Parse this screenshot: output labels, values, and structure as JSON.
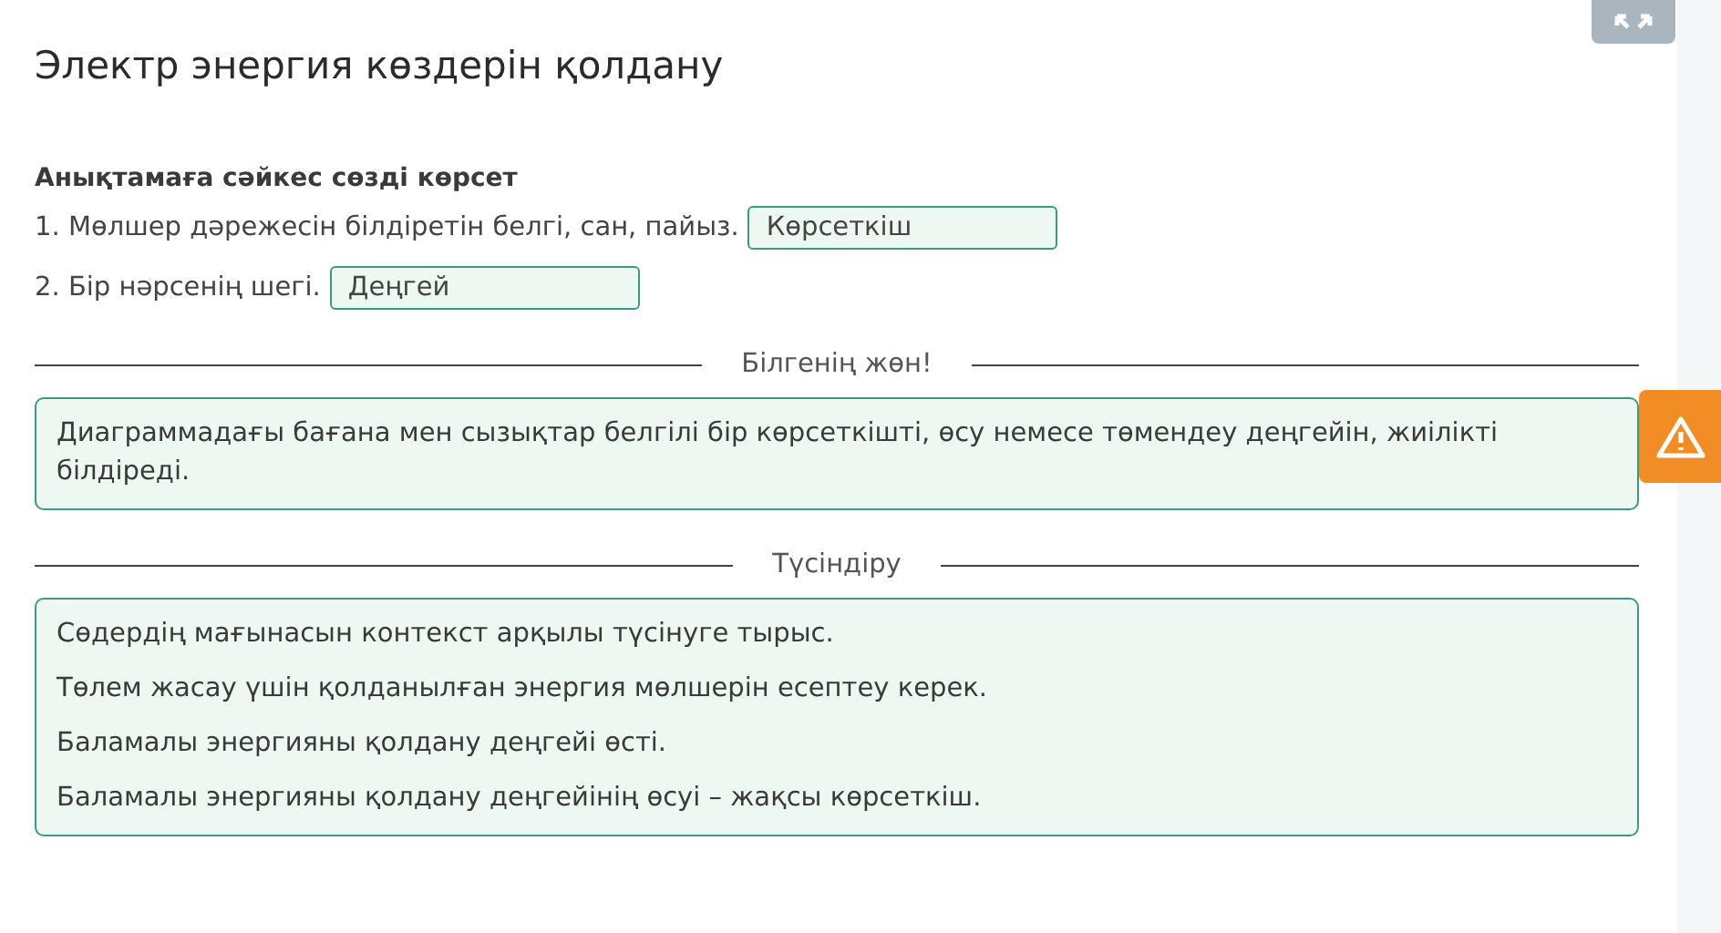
{
  "title": "Электр энергия көздерін қолдану",
  "instruction": "Анықтамаға сәйкес сөзді көрсет",
  "questions": [
    {
      "prompt": "1. Мөлшер дәрежесін білдіретін белгі, сан, пайыз.",
      "answer": "Көрсеткіш"
    },
    {
      "prompt": "2. Бір нәрсенің шегі.",
      "answer": "Деңгей"
    }
  ],
  "sections": [
    {
      "heading": "Білгенің жөн!",
      "lines": [
        "Диаграммадағы бағана мен сызықтар белгілі бір көрсеткішті, өсу немесе төмендеу деңгейін, жиілікті білдіреді."
      ]
    },
    {
      "heading": "Түсіндіру",
      "lines": [
        "Сөдердің мағынасын контекст арқылы түсінуге тырыс.",
        "Төлем жасау үшін қолданылған энергия мөлшерін есептеу керек.",
        "Баламалы энергияны қолдану деңгейі өсті.",
        "Баламалы энергияны қолдану деңгейінің өсуі – жақсы көрсеткіш."
      ]
    }
  ]
}
